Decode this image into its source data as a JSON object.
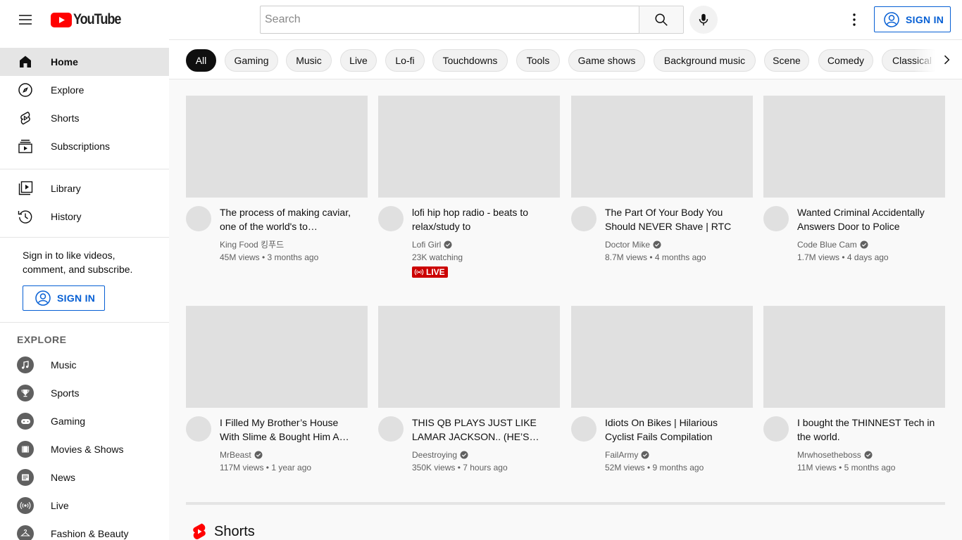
{
  "masthead": {
    "logo_text": "YouTube",
    "search_placeholder": "Search",
    "sign_in_label": "SIGN IN"
  },
  "sidebar": {
    "main_items": [
      {
        "label": "Home",
        "icon": "home-icon",
        "active": true
      },
      {
        "label": "Explore",
        "icon": "compass-icon"
      },
      {
        "label": "Shorts",
        "icon": "shorts-icon"
      },
      {
        "label": "Subscriptions",
        "icon": "subscriptions-icon"
      }
    ],
    "library_items": [
      {
        "label": "Library",
        "icon": "library-icon"
      },
      {
        "label": "History",
        "icon": "history-icon"
      }
    ],
    "signin_prompt": "Sign in to like videos, comment, and subscribe.",
    "sign_in_label": "SIGN IN",
    "explore_title": "EXPLORE",
    "explore_items": [
      {
        "label": "Music",
        "icon": "music-note-icon"
      },
      {
        "label": "Sports",
        "icon": "trophy-icon"
      },
      {
        "label": "Gaming",
        "icon": "gamepad-icon"
      },
      {
        "label": "Movies & Shows",
        "icon": "film-icon"
      },
      {
        "label": "News",
        "icon": "news-icon"
      },
      {
        "label": "Live",
        "icon": "broadcast-icon"
      },
      {
        "label": "Fashion & Beauty",
        "icon": "hanger-icon"
      }
    ]
  },
  "chips": [
    "All",
    "Gaming",
    "Music",
    "Live",
    "Lo-fi",
    "Touchdowns",
    "Tools",
    "Game shows",
    "Background music",
    "Scene",
    "Comedy",
    "Classical"
  ],
  "videos": [
    {
      "title": "The process of making caviar, one of the world's to…",
      "channel": "King Food 킹푸드",
      "verified": false,
      "meta": "45M views • 3 months ago"
    },
    {
      "title": "lofi hip hop radio - beats to relax/study to",
      "channel": "Lofi Girl",
      "verified": true,
      "meta": "23K watching",
      "live_label": "LIVE"
    },
    {
      "title": "The Part Of Your Body You Should NEVER Shave | RTC",
      "channel": "Doctor Mike",
      "verified": true,
      "meta": "8.7M views • 4 months ago"
    },
    {
      "title": "Wanted Criminal Accidentally Answers Door to Police",
      "channel": "Code Blue Cam",
      "verified": true,
      "meta": "1.7M views • 4 days ago"
    },
    {
      "title": "I Filled My Brother’s House With Slime & Bought Him A…",
      "channel": "MrBeast",
      "verified": true,
      "meta": "117M views • 1 year ago"
    },
    {
      "title": "THIS QB PLAYS JUST LIKE LAMAR JACKSON.. (HE’S…",
      "channel": "Deestroying",
      "verified": true,
      "meta": "350K views • 7 hours ago"
    },
    {
      "title": "Idiots On Bikes | Hilarious Cyclist Fails Compilation",
      "channel": "FailArmy",
      "verified": true,
      "meta": "52M views • 9 months ago"
    },
    {
      "title": "I bought the THINNEST Tech in the world.",
      "channel": "Mrwhosetheboss",
      "verified": true,
      "meta": "11M views • 5 months ago"
    }
  ],
  "shorts_title": "Shorts",
  "colors": {
    "brand_red": "#ff0000",
    "link_blue": "#065fd4",
    "live_red": "#cc0000"
  }
}
